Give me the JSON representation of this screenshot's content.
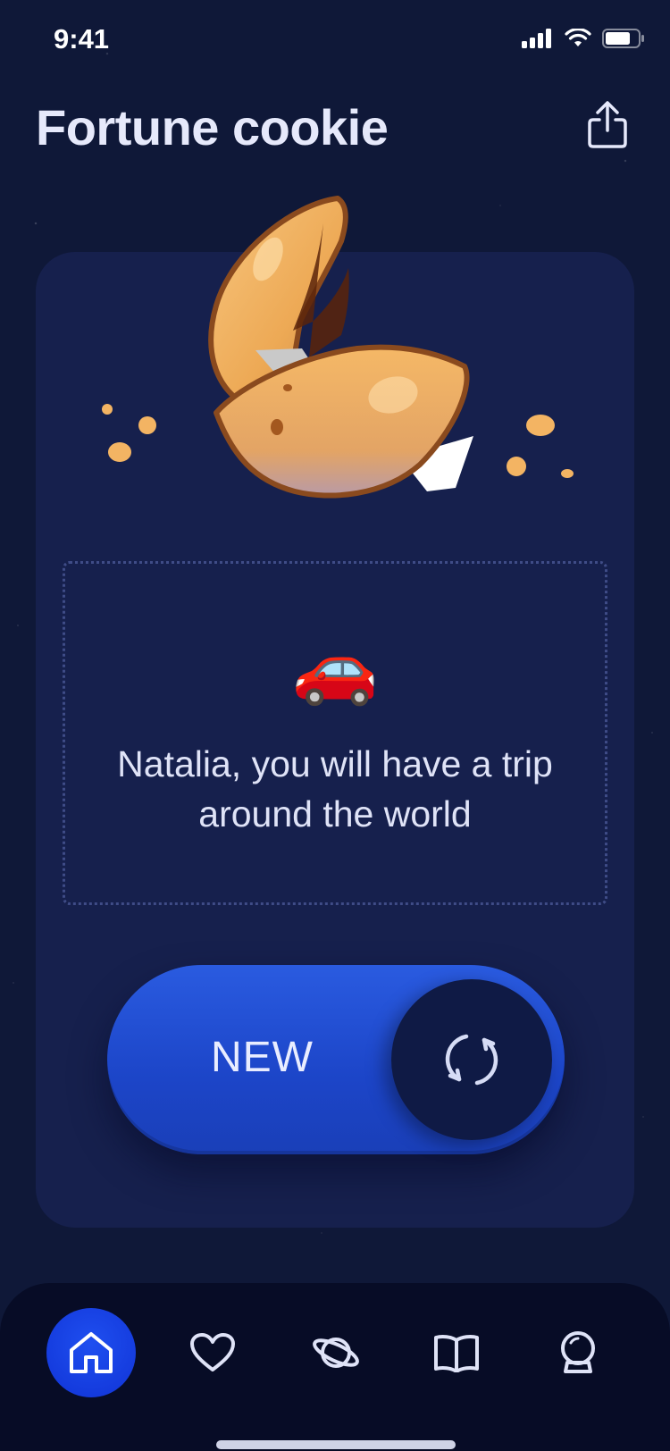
{
  "status_bar": {
    "time": "9:41"
  },
  "header": {
    "title": "Fortune cookie"
  },
  "fortune": {
    "emoji": "🚗",
    "text": "Natalia, you will have a trip around the world"
  },
  "new_button": {
    "label": "NEW"
  },
  "tabs": [
    {
      "icon": "home-icon",
      "active": true
    },
    {
      "icon": "heart-icon",
      "active": false
    },
    {
      "icon": "planet-icon",
      "active": false
    },
    {
      "icon": "book-icon",
      "active": false
    },
    {
      "icon": "crystal-ball-icon",
      "active": false
    }
  ],
  "colors": {
    "background": "#0f1838",
    "card": "#16204d",
    "accent": "#1f4ff0",
    "text": "#e6e9fb",
    "cookie": "#f3b463"
  }
}
